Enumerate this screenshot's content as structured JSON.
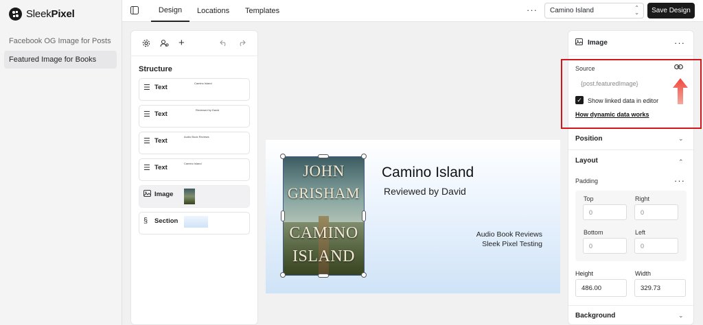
{
  "app": {
    "logo_text_regular": "Sleek",
    "logo_text_bold": "Pixel"
  },
  "sidebar": {
    "items": [
      {
        "label": "Facebook OG Image for Posts",
        "active": false
      },
      {
        "label": "Featured Image for Books",
        "active": true
      }
    ]
  },
  "topbar": {
    "tabs": [
      {
        "label": "Design",
        "active": true
      },
      {
        "label": "Locations",
        "active": false
      },
      {
        "label": "Templates",
        "active": false
      }
    ],
    "more_label": "···",
    "template_select_value": "Camino Island",
    "save_label": "Save Design"
  },
  "structure": {
    "title": "Structure",
    "layers": [
      {
        "label": "Text",
        "icon": "text-align-icon",
        "preview": "Camino Island"
      },
      {
        "label": "Text",
        "icon": "text-align-icon",
        "preview": "Reviewed by David"
      },
      {
        "label": "Text",
        "icon": "text-align-icon",
        "preview": "Audio Book Reviews"
      },
      {
        "label": "Text",
        "icon": "text-align-icon",
        "preview": "Camino Island"
      },
      {
        "label": "Image",
        "icon": "image-icon",
        "selected": true
      },
      {
        "label": "Section",
        "icon": "section-icon"
      }
    ]
  },
  "canvas": {
    "book": {
      "author_line1": "JOHN",
      "author_line2": "GRISHAM",
      "title_line1": "CAMINO",
      "title_line2": "ISLAND"
    },
    "title": "Camino Island",
    "subtitle": "Reviewed by David",
    "right_line1": "Audio Book Reviews",
    "right_line2": "Sleek Pixel Testing"
  },
  "properties": {
    "header": "Image",
    "more_label": "···",
    "source_label": "Source",
    "source_value": "{post.featuredImage}",
    "show_linked_label": "Show linked data in editor",
    "show_linked_checked": true,
    "dynamic_link": "How dynamic data works",
    "sections": {
      "position": "Position",
      "layout": "Layout",
      "background": "Background"
    },
    "padding": {
      "label": "Padding",
      "top_label": "Top",
      "top_value": "0",
      "right_label": "Right",
      "right_value": "0",
      "bottom_label": "Bottom",
      "bottom_value": "0",
      "left_label": "Left",
      "left_value": "0"
    },
    "height_label": "Height",
    "height_value": "486.00",
    "width_label": "Width",
    "width_value": "329.73"
  },
  "colors": {
    "accent": "#1b1b1b",
    "highlight": "#d0151b",
    "arrow": "#e85a4f"
  }
}
